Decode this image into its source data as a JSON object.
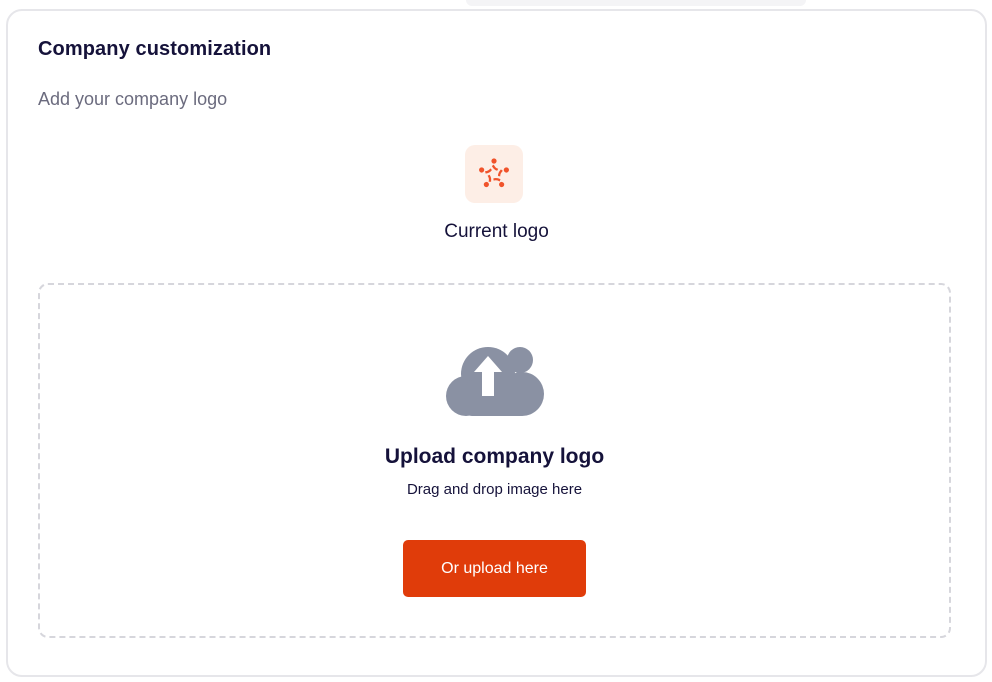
{
  "card": {
    "title": "Company customization",
    "subtitle": "Add your company logo"
  },
  "current_logo": {
    "label": "Current logo",
    "icon": "company-logo-icon",
    "tile_color": "#fdeee6",
    "logo_color": "#f0532b"
  },
  "upload": {
    "icon": "cloud-upload-icon",
    "icon_color": "#8a91a3",
    "title": "Upload company logo",
    "hint": "Drag and drop image here",
    "button_label": "Or upload here",
    "button_color": "#e03c0a"
  }
}
